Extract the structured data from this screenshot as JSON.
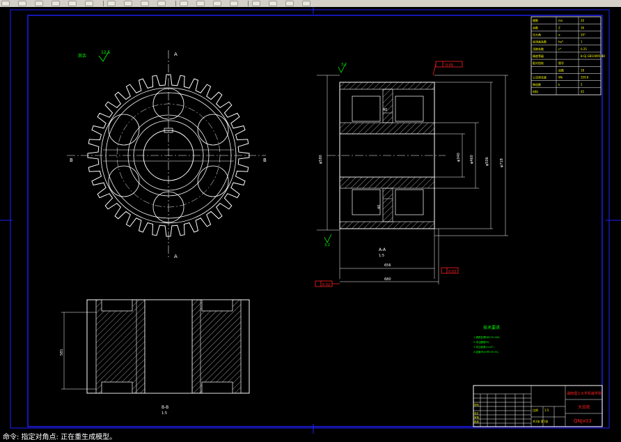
{
  "toolbar": {
    "buttons": [
      "new-icon",
      "open-icon",
      "save-icon",
      "print-icon",
      "undo-icon",
      "redo-icon",
      "pan-icon",
      "zoom-realtime-icon",
      "zoom-window-icon",
      "zoom-previous-icon",
      "properties-icon",
      "design-center-icon",
      "tool-palettes-icon",
      "text-icon",
      "layer-icon",
      "layer-previous-icon",
      "color-icon",
      "linetype-icon"
    ]
  },
  "drawing": {
    "section_labels": {
      "top_view_marker_top": "A",
      "top_view_marker_bottom": "A",
      "side_marker_left": "B",
      "side_marker_right": "B",
      "section_aa": "A-A",
      "section_aa_scale": "1:5",
      "section_bb": "B-B",
      "section_bb_scale": "1:5"
    },
    "surface_finish": {
      "label_left": "其余",
      "value_left": "12.5",
      "value_right": "3.2",
      "value_bottom": "3.2"
    },
    "dimensions": {
      "d1": "φ580",
      "d2": "φ340",
      "d3": "φ460",
      "d4": "φ250",
      "d5": "φ506",
      "d6": "φ718",
      "w1": "40",
      "w2": "40",
      "len1": "656",
      "len2": "680",
      "h_side": "581"
    },
    "tolerance_frames": {
      "top": "0.05",
      "mid": "0.03",
      "left": "0.02"
    },
    "param_table": {
      "rows": [
        {
          "name": "模数",
          "sym": "mn",
          "val": "20"
        },
        {
          "name": "齿数",
          "sym": "Z",
          "val": "36"
        },
        {
          "name": "压力角",
          "sym": "α",
          "val": "20°"
        },
        {
          "name": "齿顶高系数",
          "sym": "ha*",
          "val": "1"
        },
        {
          "name": "顶隙系数",
          "sym": "c*",
          "val": "0.25"
        },
        {
          "name": "精度等级",
          "sym": "",
          "val": "8-GJ GB10095-88"
        },
        {
          "name": "配对齿轮",
          "sym": "图号",
          "val": ""
        },
        {
          "name": "",
          "sym": "齿数",
          "val": "18"
        },
        {
          "name": "公法线长度",
          "sym": "Wk",
          "val": "359.6"
        },
        {
          "name": "跨齿数",
          "sym": "k",
          "val": "5"
        },
        {
          "name": "材料",
          "sym": "",
          "val": "45"
        }
      ]
    },
    "tech_requirements": {
      "title": "技术要求",
      "lines": [
        "1.调质处理HB220-260。",
        "2.未注圆角R5。",
        "3.未注倒角2×45°。",
        "4.齿面淬火HRC45-50。"
      ]
    },
    "title_block": {
      "school": "湖南理工大学机械学院",
      "part_name": "大齿轮",
      "drawing_no": "QNJx03",
      "scale_label": "比例",
      "scale_val": "1:5",
      "sheet_label": "共1张 第1张",
      "designer_label": "设计",
      "checker_label": "审核",
      "approver_label": "批准",
      "material_label": "材料"
    }
  },
  "command_line": {
    "text": "命令: 指定对角点: 正在重生成模型。"
  },
  "colors": {
    "background": "#000000",
    "line": "#ffffff",
    "frame": "#2020ff",
    "green": "#00ff00",
    "red": "#ff2020",
    "yellow": "#ffff00"
  }
}
